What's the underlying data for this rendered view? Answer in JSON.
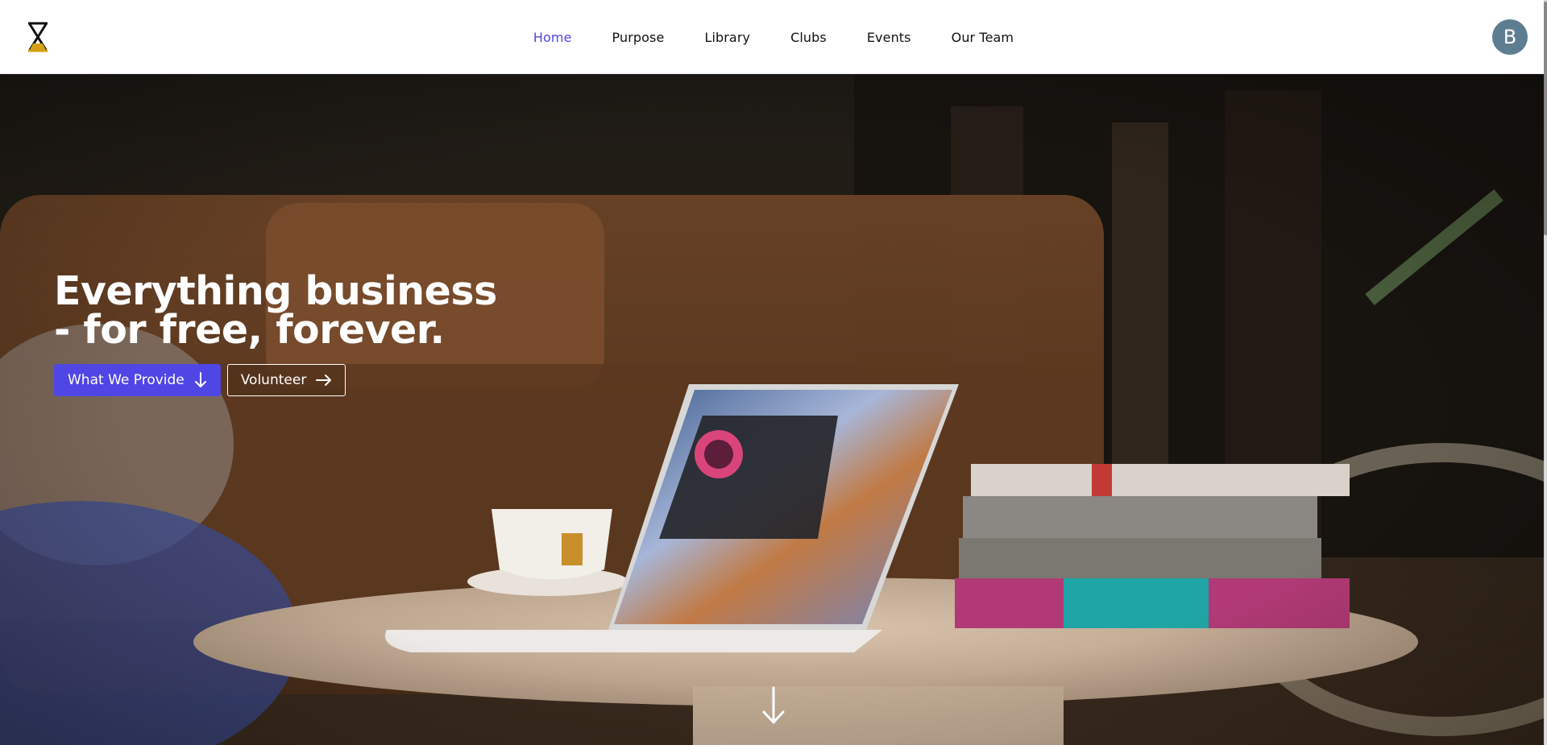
{
  "nav": {
    "links": [
      "Home",
      "Purpose",
      "Library",
      "Clubs",
      "Events",
      "Our Team"
    ],
    "active": "Home",
    "avatar_initial": "B"
  },
  "hero": {
    "title_line1": "Everything business",
    "title_line2": "- for free, forever.",
    "primary_button": "What We Provide",
    "secondary_button": "Volunteer"
  },
  "colors": {
    "accent": "#4f46e5",
    "avatar": "#5f7d90",
    "logo_gold": "#d4a017"
  },
  "icons": {
    "logo": "hourglass-logo-icon",
    "primary_button": "arrow-down-icon",
    "secondary_button": "arrow-right-icon",
    "scroll": "scroll-down-arrow-icon"
  }
}
